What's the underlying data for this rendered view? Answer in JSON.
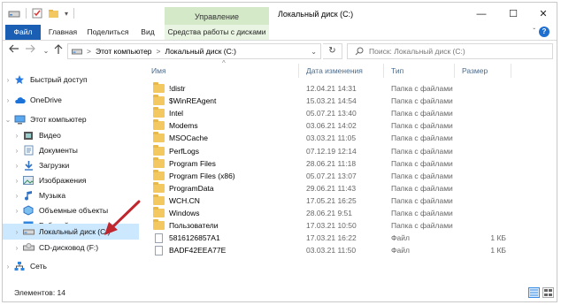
{
  "window": {
    "title": "Локальный диск (C:)",
    "manage_tab": "Управление",
    "controls": {
      "minimize": "—",
      "maximize": "☐",
      "close": "✕"
    }
  },
  "ribbon": {
    "tabs": [
      "Файл",
      "Главная",
      "Поделиться",
      "Вид",
      "Средства работы с дисками"
    ],
    "help": "?",
    "collapse": "ˇ"
  },
  "address": {
    "crumbs": [
      "Этот компьютер",
      "Локальный диск (C:)"
    ],
    "separator": ">",
    "search_placeholder": "Поиск: Локальный диск (C:)"
  },
  "nav": {
    "items": [
      {
        "label": "Быстрый доступ",
        "icon": "star-icon"
      },
      {
        "label": "OneDrive",
        "icon": "cloud-icon"
      },
      {
        "label": "Этот компьютер",
        "icon": "computer-icon"
      },
      {
        "label": "Видео",
        "icon": "video-icon"
      },
      {
        "label": "Документы",
        "icon": "documents-icon"
      },
      {
        "label": "Загрузки",
        "icon": "download-icon"
      },
      {
        "label": "Изображения",
        "icon": "pictures-icon"
      },
      {
        "label": "Музыка",
        "icon": "music-icon"
      },
      {
        "label": "Объемные объекты",
        "icon": "3d-objects-icon"
      },
      {
        "label": "Рабочий стол",
        "icon": "desktop-icon"
      },
      {
        "label": "Локальный диск (C:)",
        "icon": "drive-icon"
      },
      {
        "label": "CD-дисковод (F:)",
        "icon": "cd-drive-icon"
      },
      {
        "label": "Сеть",
        "icon": "network-icon"
      }
    ]
  },
  "columns": {
    "name": "Имя",
    "date": "Дата изменения",
    "type": "Тип",
    "size": "Размер"
  },
  "files": [
    {
      "name": "!distr",
      "date": "12.04.21 14:31",
      "type": "Папка с файлами",
      "size": "",
      "kind": "folder"
    },
    {
      "name": "$WinREAgent",
      "date": "15.03.21 14:54",
      "type": "Папка с файлами",
      "size": "",
      "kind": "folder"
    },
    {
      "name": "Intel",
      "date": "05.07.21 13:40",
      "type": "Папка с файлами",
      "size": "",
      "kind": "folder"
    },
    {
      "name": "Modems",
      "date": "03.06.21 14:02",
      "type": "Папка с файлами",
      "size": "",
      "kind": "folder"
    },
    {
      "name": "MSOCache",
      "date": "03.03.21 11:05",
      "type": "Папка с файлами",
      "size": "",
      "kind": "folder"
    },
    {
      "name": "PerfLogs",
      "date": "07.12.19 12:14",
      "type": "Папка с файлами",
      "size": "",
      "kind": "folder"
    },
    {
      "name": "Program Files",
      "date": "28.06.21 11:18",
      "type": "Папка с файлами",
      "size": "",
      "kind": "folder"
    },
    {
      "name": "Program Files (x86)",
      "date": "05.07.21 13:07",
      "type": "Папка с файлами",
      "size": "",
      "kind": "folder"
    },
    {
      "name": "ProgramData",
      "date": "29.06.21 11:43",
      "type": "Папка с файлами",
      "size": "",
      "kind": "folder"
    },
    {
      "name": "WCH.CN",
      "date": "17.05.21 16:25",
      "type": "Папка с файлами",
      "size": "",
      "kind": "folder"
    },
    {
      "name": "Windows",
      "date": "28.06.21 9:51",
      "type": "Папка с файлами",
      "size": "",
      "kind": "folder"
    },
    {
      "name": "Пользователи",
      "date": "17.03.21 10:50",
      "type": "Папка с файлами",
      "size": "",
      "kind": "folder"
    },
    {
      "name": "5816126857A1",
      "date": "17.03.21 16:22",
      "type": "Файл",
      "size": "1 КБ",
      "kind": "file"
    },
    {
      "name": "BADF42EEA77E",
      "date": "03.03.21 11:50",
      "type": "Файл",
      "size": "1 КБ",
      "kind": "file"
    }
  ],
  "status": {
    "count": "Элементов: 14"
  },
  "colors": {
    "accent": "#1a5fb4",
    "manage": "#d4e9c8",
    "selected": "#cce8ff",
    "folder": "#f3c860",
    "arrow": "#c0262d"
  }
}
